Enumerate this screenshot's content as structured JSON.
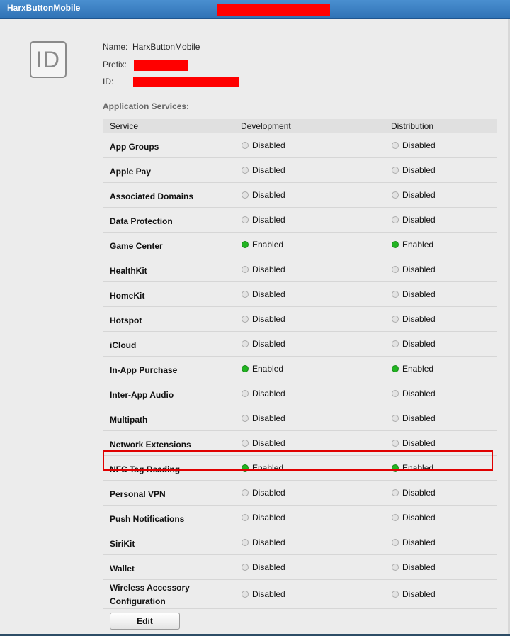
{
  "app": {
    "title": "HarxButtonMobile"
  },
  "identifier": {
    "icon_text": "ID",
    "name_label": "Name:",
    "name_value": "HarxButtonMobile",
    "prefix_label": "Prefix:",
    "id_label": "ID:"
  },
  "services": {
    "section_title": "Application Services:",
    "columns": [
      "Service",
      "Development",
      "Distribution"
    ],
    "rows": [
      {
        "service": "App Groups",
        "development": "Disabled",
        "distribution": "Disabled"
      },
      {
        "service": "Apple Pay",
        "development": "Disabled",
        "distribution": "Disabled"
      },
      {
        "service": "Associated Domains",
        "development": "Disabled",
        "distribution": "Disabled"
      },
      {
        "service": "Data Protection",
        "development": "Disabled",
        "distribution": "Disabled"
      },
      {
        "service": "Game Center",
        "development": "Enabled",
        "distribution": "Enabled"
      },
      {
        "service": "HealthKit",
        "development": "Disabled",
        "distribution": "Disabled"
      },
      {
        "service": "HomeKit",
        "development": "Disabled",
        "distribution": "Disabled"
      },
      {
        "service": "Hotspot",
        "development": "Disabled",
        "distribution": "Disabled"
      },
      {
        "service": "iCloud",
        "development": "Disabled",
        "distribution": "Disabled"
      },
      {
        "service": "In-App Purchase",
        "development": "Enabled",
        "distribution": "Enabled"
      },
      {
        "service": "Inter-App Audio",
        "development": "Disabled",
        "distribution": "Disabled"
      },
      {
        "service": "Multipath",
        "development": "Disabled",
        "distribution": "Disabled"
      },
      {
        "service": "Network Extensions",
        "development": "Disabled",
        "distribution": "Disabled"
      },
      {
        "service": "NFC Tag Reading",
        "development": "Enabled",
        "distribution": "Enabled"
      },
      {
        "service": "Personal VPN",
        "development": "Disabled",
        "distribution": "Disabled"
      },
      {
        "service": "Push Notifications",
        "development": "Disabled",
        "distribution": "Disabled"
      },
      {
        "service": "SiriKit",
        "development": "Disabled",
        "distribution": "Disabled"
      },
      {
        "service": "Wallet",
        "development": "Disabled",
        "distribution": "Disabled"
      },
      {
        "service": "Wireless Accessory Configuration",
        "development": "Disabled",
        "distribution": "Disabled"
      }
    ]
  },
  "actions": {
    "edit_label": "Edit"
  },
  "colors": {
    "enabled": "#22b422",
    "disabled": "#e3e3e3",
    "highlight": "#e00000",
    "redaction": "#ff0000",
    "titlebar": "#2f72b5"
  }
}
